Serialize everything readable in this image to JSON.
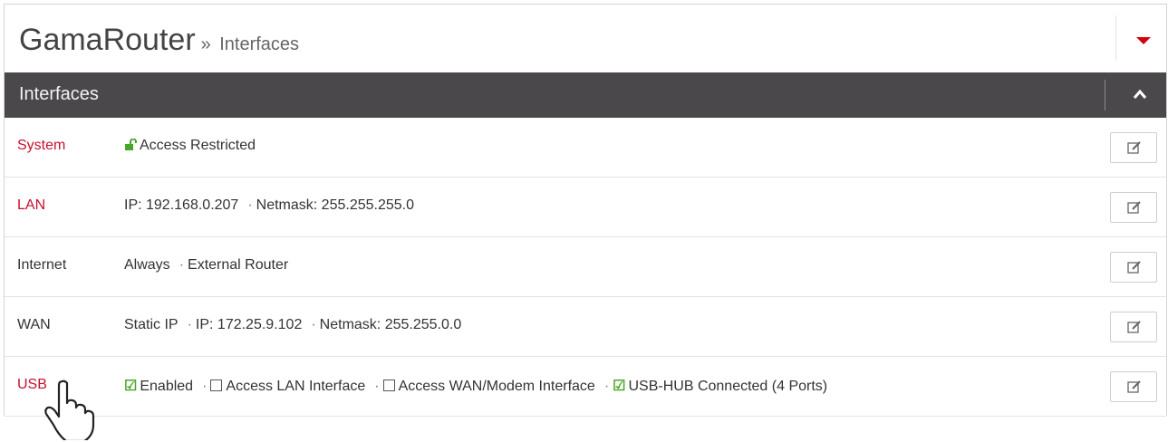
{
  "header": {
    "app_title": "GamaRouter",
    "separator": "»",
    "breadcrumb": "Interfaces"
  },
  "section": {
    "title": "Interfaces"
  },
  "rows": [
    {
      "name": "System",
      "items": [
        "Access Restricted"
      ]
    },
    {
      "name": "LAN",
      "items": [
        "IP: 192.168.0.207",
        "Netmask: 255.255.255.0"
      ]
    },
    {
      "name": "Internet",
      "items": [
        "Always",
        "External Router"
      ]
    },
    {
      "name": "WAN",
      "items": [
        "Static IP",
        "IP: 172.25.9.102",
        "Netmask: 255.255.0.0"
      ]
    },
    {
      "name": "USB",
      "items": [
        "Enabled",
        "Access LAN Interface",
        "Access WAN/Modem Interface",
        "USB-HUB Connected (4 Ports)"
      ]
    }
  ],
  "separator_glyph": "·",
  "colors": {
    "accent_red": "#c8102e",
    "header_bar": "#4a484b",
    "check_green": "#4aa62a"
  },
  "icons": [
    "caret-down-icon",
    "chevron-up-icon",
    "unlock-icon",
    "edit-icon",
    "check-icon",
    "checkbox-empty-icon",
    "hand-cursor-icon"
  ]
}
